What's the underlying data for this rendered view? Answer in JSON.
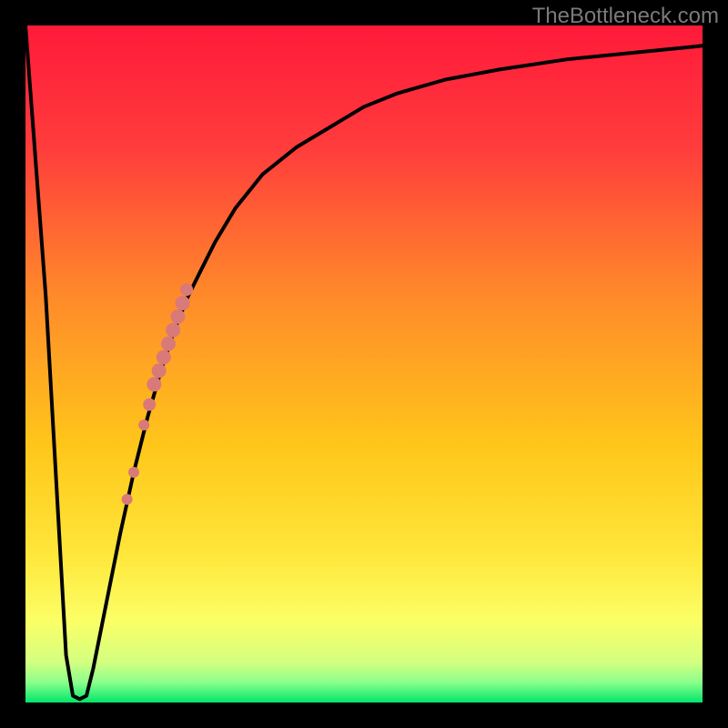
{
  "attribution": "TheBottleneck.com",
  "colors": {
    "frame": "#000000",
    "gradient_top": "#ff1a3a",
    "gradient_mid": "#ffcc00",
    "gradient_low": "#ffff66",
    "gradient_bottom": "#00e66a",
    "curve": "#000000",
    "dots": "#d97a78",
    "text": "#7a7a7a"
  },
  "chart_data": {
    "type": "line",
    "title": "",
    "xlabel": "",
    "ylabel": "",
    "xlim": [
      0,
      100
    ],
    "ylim": [
      0,
      100
    ],
    "series": [
      {
        "name": "bottleneck-curve",
        "x": [
          0,
          3,
          6,
          7,
          8,
          9,
          10,
          12,
          14,
          16,
          18,
          20,
          22,
          24,
          26,
          28,
          31,
          35,
          40,
          45,
          50,
          55,
          62,
          70,
          80,
          90,
          100
        ],
        "y": [
          100,
          60,
          7,
          1,
          0.5,
          1,
          5,
          15,
          25,
          34,
          42,
          49,
          55,
          60,
          64,
          68,
          73,
          78,
          82,
          85,
          88,
          90,
          92,
          93.5,
          95,
          96,
          97
        ]
      }
    ],
    "markers": [
      {
        "x": 15.0,
        "y": 30,
        "r": 6
      },
      {
        "x": 16.0,
        "y": 34,
        "r": 6
      },
      {
        "x": 17.5,
        "y": 41,
        "r": 6
      },
      {
        "x": 18.3,
        "y": 44,
        "r": 7
      },
      {
        "x": 19.0,
        "y": 47,
        "r": 8
      },
      {
        "x": 19.7,
        "y": 49,
        "r": 8
      },
      {
        "x": 20.4,
        "y": 51,
        "r": 8
      },
      {
        "x": 21.1,
        "y": 53,
        "r": 8
      },
      {
        "x": 21.8,
        "y": 55,
        "r": 8
      },
      {
        "x": 22.5,
        "y": 57,
        "r": 8
      },
      {
        "x": 23.2,
        "y": 59,
        "r": 8
      },
      {
        "x": 23.8,
        "y": 61,
        "r": 7
      }
    ]
  }
}
